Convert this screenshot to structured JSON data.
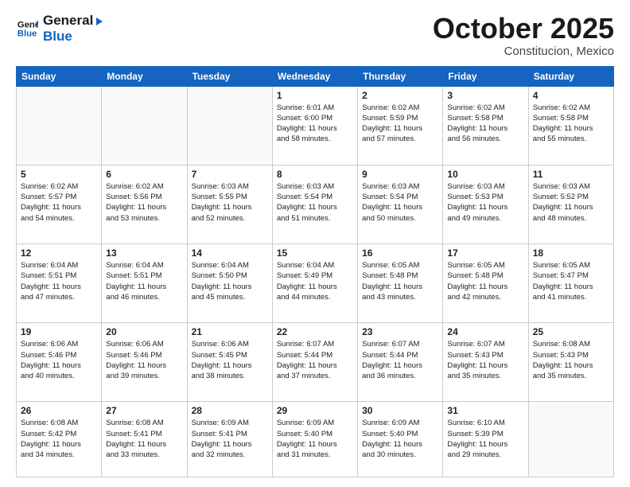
{
  "logo": {
    "line1": "General",
    "line2": "Blue"
  },
  "title": "October 2025",
  "subtitle": "Constitucion, Mexico",
  "days_header": [
    "Sunday",
    "Monday",
    "Tuesday",
    "Wednesday",
    "Thursday",
    "Friday",
    "Saturday"
  ],
  "weeks": [
    [
      {
        "num": "",
        "info": ""
      },
      {
        "num": "",
        "info": ""
      },
      {
        "num": "",
        "info": ""
      },
      {
        "num": "1",
        "info": "Sunrise: 6:01 AM\nSunset: 6:00 PM\nDaylight: 11 hours\nand 58 minutes."
      },
      {
        "num": "2",
        "info": "Sunrise: 6:02 AM\nSunset: 5:59 PM\nDaylight: 11 hours\nand 57 minutes."
      },
      {
        "num": "3",
        "info": "Sunrise: 6:02 AM\nSunset: 5:58 PM\nDaylight: 11 hours\nand 56 minutes."
      },
      {
        "num": "4",
        "info": "Sunrise: 6:02 AM\nSunset: 5:58 PM\nDaylight: 11 hours\nand 55 minutes."
      }
    ],
    [
      {
        "num": "5",
        "info": "Sunrise: 6:02 AM\nSunset: 5:57 PM\nDaylight: 11 hours\nand 54 minutes."
      },
      {
        "num": "6",
        "info": "Sunrise: 6:02 AM\nSunset: 5:56 PM\nDaylight: 11 hours\nand 53 minutes."
      },
      {
        "num": "7",
        "info": "Sunrise: 6:03 AM\nSunset: 5:55 PM\nDaylight: 11 hours\nand 52 minutes."
      },
      {
        "num": "8",
        "info": "Sunrise: 6:03 AM\nSunset: 5:54 PM\nDaylight: 11 hours\nand 51 minutes."
      },
      {
        "num": "9",
        "info": "Sunrise: 6:03 AM\nSunset: 5:54 PM\nDaylight: 11 hours\nand 50 minutes."
      },
      {
        "num": "10",
        "info": "Sunrise: 6:03 AM\nSunset: 5:53 PM\nDaylight: 11 hours\nand 49 minutes."
      },
      {
        "num": "11",
        "info": "Sunrise: 6:03 AM\nSunset: 5:52 PM\nDaylight: 11 hours\nand 48 minutes."
      }
    ],
    [
      {
        "num": "12",
        "info": "Sunrise: 6:04 AM\nSunset: 5:51 PM\nDaylight: 11 hours\nand 47 minutes."
      },
      {
        "num": "13",
        "info": "Sunrise: 6:04 AM\nSunset: 5:51 PM\nDaylight: 11 hours\nand 46 minutes."
      },
      {
        "num": "14",
        "info": "Sunrise: 6:04 AM\nSunset: 5:50 PM\nDaylight: 11 hours\nand 45 minutes."
      },
      {
        "num": "15",
        "info": "Sunrise: 6:04 AM\nSunset: 5:49 PM\nDaylight: 11 hours\nand 44 minutes."
      },
      {
        "num": "16",
        "info": "Sunrise: 6:05 AM\nSunset: 5:48 PM\nDaylight: 11 hours\nand 43 minutes."
      },
      {
        "num": "17",
        "info": "Sunrise: 6:05 AM\nSunset: 5:48 PM\nDaylight: 11 hours\nand 42 minutes."
      },
      {
        "num": "18",
        "info": "Sunrise: 6:05 AM\nSunset: 5:47 PM\nDaylight: 11 hours\nand 41 minutes."
      }
    ],
    [
      {
        "num": "19",
        "info": "Sunrise: 6:06 AM\nSunset: 5:46 PM\nDaylight: 11 hours\nand 40 minutes."
      },
      {
        "num": "20",
        "info": "Sunrise: 6:06 AM\nSunset: 5:46 PM\nDaylight: 11 hours\nand 39 minutes."
      },
      {
        "num": "21",
        "info": "Sunrise: 6:06 AM\nSunset: 5:45 PM\nDaylight: 11 hours\nand 38 minutes."
      },
      {
        "num": "22",
        "info": "Sunrise: 6:07 AM\nSunset: 5:44 PM\nDaylight: 11 hours\nand 37 minutes."
      },
      {
        "num": "23",
        "info": "Sunrise: 6:07 AM\nSunset: 5:44 PM\nDaylight: 11 hours\nand 36 minutes."
      },
      {
        "num": "24",
        "info": "Sunrise: 6:07 AM\nSunset: 5:43 PM\nDaylight: 11 hours\nand 35 minutes."
      },
      {
        "num": "25",
        "info": "Sunrise: 6:08 AM\nSunset: 5:43 PM\nDaylight: 11 hours\nand 35 minutes."
      }
    ],
    [
      {
        "num": "26",
        "info": "Sunrise: 6:08 AM\nSunset: 5:42 PM\nDaylight: 11 hours\nand 34 minutes."
      },
      {
        "num": "27",
        "info": "Sunrise: 6:08 AM\nSunset: 5:41 PM\nDaylight: 11 hours\nand 33 minutes."
      },
      {
        "num": "28",
        "info": "Sunrise: 6:09 AM\nSunset: 5:41 PM\nDaylight: 11 hours\nand 32 minutes."
      },
      {
        "num": "29",
        "info": "Sunrise: 6:09 AM\nSunset: 5:40 PM\nDaylight: 11 hours\nand 31 minutes."
      },
      {
        "num": "30",
        "info": "Sunrise: 6:09 AM\nSunset: 5:40 PM\nDaylight: 11 hours\nand 30 minutes."
      },
      {
        "num": "31",
        "info": "Sunrise: 6:10 AM\nSunset: 5:39 PM\nDaylight: 11 hours\nand 29 minutes."
      },
      {
        "num": "",
        "info": ""
      }
    ]
  ]
}
